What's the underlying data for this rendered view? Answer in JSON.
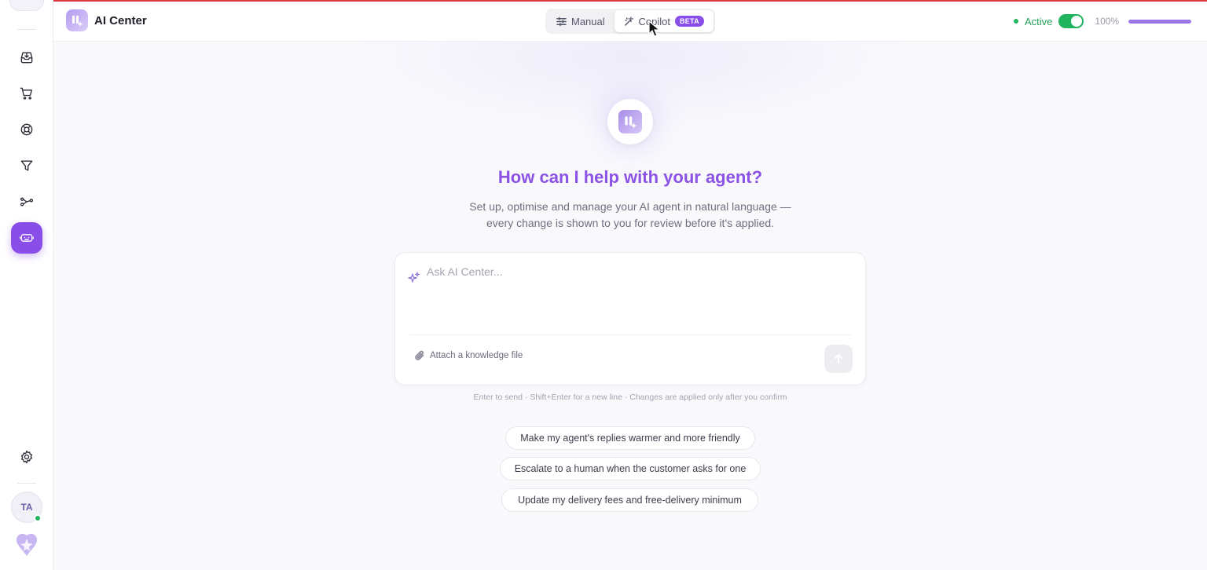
{
  "app": {
    "title": "AI Center"
  },
  "mode_switch": {
    "manual_label": "Manual",
    "copilot_label": "Copilot",
    "beta_badge": "BETA",
    "selected": "Copilot"
  },
  "status": {
    "label": "Active",
    "toggle_on": true,
    "percent_text": "100%",
    "progress": 1.0
  },
  "sidebar": {
    "items": [
      {
        "icon": "inbox-icon",
        "active": false
      },
      {
        "icon": "cart-icon",
        "active": false
      },
      {
        "icon": "lifebuoy-icon",
        "active": false
      },
      {
        "icon": "filter-icon",
        "active": false
      },
      {
        "icon": "integrations-icon",
        "active": false
      },
      {
        "icon": "ai-bot-icon",
        "active": true
      }
    ],
    "settings_icon": "gear-icon",
    "user_initials": "TA",
    "user_online": true
  },
  "hero": {
    "headline": "How can I help with your agent?",
    "subtitle_line1": "Set up, optimise and manage your AI agent in natural language —",
    "subtitle_line2": "every change is shown to you for review before it's applied."
  },
  "composer": {
    "placeholder": "Ask AI Center...",
    "value": "",
    "attach_label": "Attach a knowledge file"
  },
  "hint": "Enter to send · Shift+Enter for a new line · Changes are applied only after you confirm",
  "suggestions": [
    "Make my agent's replies warmer and more friendly",
    "Escalate to a human when the customer asks for one",
    "Update my delivery fees and free-delivery minimum"
  ],
  "colors": {
    "accent": "#8a4ee8",
    "headline": "#8b52e6",
    "success": "#22b35e",
    "top_line": "#d9363e"
  }
}
